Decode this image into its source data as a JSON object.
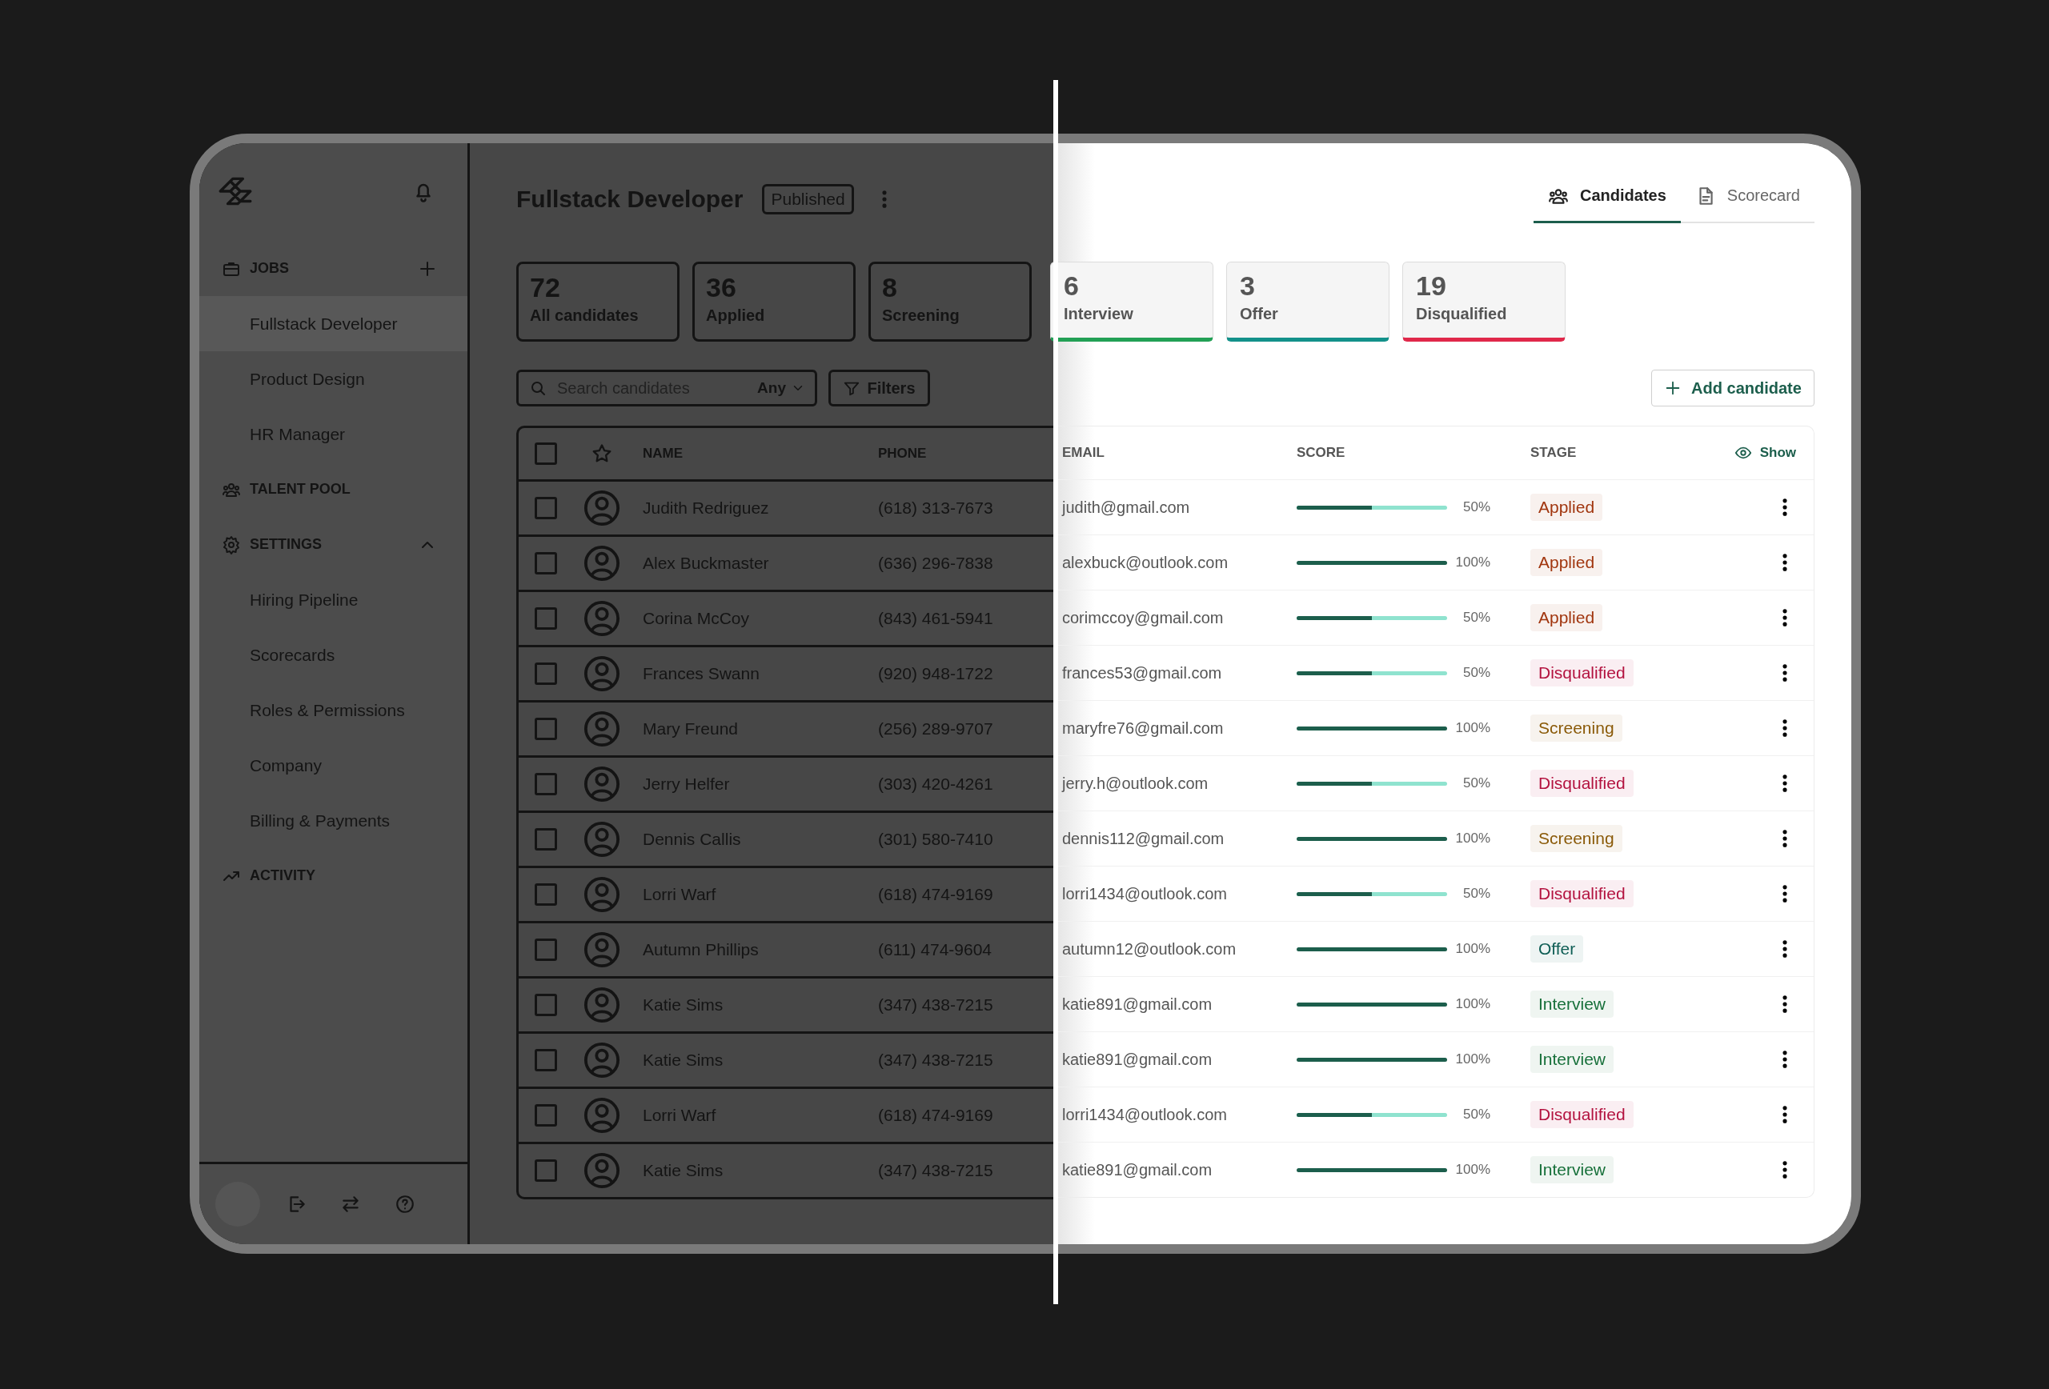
{
  "sidebar": {
    "sections": [
      {
        "kind": "jobs",
        "label": "JOBS",
        "children": [
          {
            "label": "Fullstack Developer",
            "selected": true
          },
          {
            "label": "Product Design",
            "selected": false
          },
          {
            "label": "HR Manager",
            "selected": false
          }
        ]
      },
      {
        "kind": "talent_pool",
        "label": "TALENT POOL"
      },
      {
        "kind": "settings",
        "label": "SETTINGS",
        "expanded": true,
        "children": [
          {
            "label": "Hiring Pipeline",
            "selected": false
          },
          {
            "label": "Scorecards",
            "selected": false
          },
          {
            "label": "Roles & Permissions",
            "selected": false
          },
          {
            "label": "Company",
            "selected": false
          },
          {
            "label": "Billing & Payments",
            "selected": false
          }
        ]
      },
      {
        "kind": "activity",
        "label": "ACTIVITY"
      }
    ]
  },
  "job": {
    "title": "Fullstack Developer",
    "status": "Published"
  },
  "tabs": [
    {
      "label": "Candidates",
      "selected": true
    },
    {
      "label": "Scorecard",
      "selected": false
    }
  ],
  "stats": [
    {
      "count": "72",
      "label": "All candidates"
    },
    {
      "count": "36",
      "label": "Applied"
    },
    {
      "count": "8",
      "label": "Screening"
    },
    {
      "count": "6",
      "label": "Interview",
      "color": "#22a055"
    },
    {
      "count": "3",
      "label": "Offer",
      "color": "#13918a"
    },
    {
      "count": "19",
      "label": "Disqualified",
      "color": "#e0284a"
    }
  ],
  "search": {
    "placeholder": "Search candidates",
    "scope": "Any"
  },
  "filters_button": "Filters",
  "add_button": "Add candidate",
  "table": {
    "all_checked": false,
    "columns": [
      "NAME",
      "PHONE",
      "EMAIL",
      "SCORE",
      "STAGE"
    ],
    "show_button": "Show",
    "rows": [
      {
        "checked": false,
        "name": "Judith Redriguez",
        "phone": "(618) 313-7673",
        "email": "judith@gmail.com",
        "level": 0.5,
        "score": "50%",
        "stage": {
          "label": "Applied",
          "color": "#a1360f"
        }
      },
      {
        "checked": false,
        "name": "Alex Buckmaster",
        "phone": "(636) 296-7838",
        "email": "alexbuck@outlook.com",
        "level": 1,
        "score": "100%",
        "stage": {
          "label": "Applied",
          "color": "#a1360f"
        }
      },
      {
        "checked": false,
        "name": "Corina McCoy",
        "phone": "(843) 461-5941",
        "email": "corimccoy@gmail.com",
        "level": 0.5,
        "score": "50%",
        "stage": {
          "label": "Applied",
          "color": "#a1360f"
        }
      },
      {
        "checked": false,
        "name": "Frances Swann",
        "phone": "(920) 948-1722",
        "email": "frances53@gmail.com",
        "level": 0.5,
        "score": "50%",
        "stage": {
          "label": "Disqualified",
          "color": "#b3123f"
        }
      },
      {
        "checked": false,
        "name": "Mary Freund",
        "phone": "(256) 289-9707",
        "email": "maryfre76@gmail.com",
        "level": 1,
        "score": "100%",
        "stage": {
          "label": "Screening",
          "color": "#8a5a08"
        }
      },
      {
        "checked": false,
        "name": "Jerry Helfer",
        "phone": "(303) 420-4261",
        "email": "jerry.h@outlook.com",
        "level": 0.5,
        "score": "50%",
        "stage": {
          "label": "Disqualified",
          "color": "#b3123f"
        }
      },
      {
        "checked": false,
        "name": "Dennis Callis",
        "phone": "(301) 580-7410",
        "email": "dennis112@gmail.com",
        "level": 1,
        "score": "100%",
        "stage": {
          "label": "Screening",
          "color": "#8a5a08"
        }
      },
      {
        "checked": false,
        "name": "Lorri Warf",
        "phone": "(618) 474-9169",
        "email": "lorri1434@outlook.com",
        "level": 0.5,
        "score": "50%",
        "stage": {
          "label": "Disqualified",
          "color": "#b3123f"
        }
      },
      {
        "checked": false,
        "name": "Autumn Phillips",
        "phone": "(611) 474-9604",
        "email": "autumn12@outlook.com",
        "level": 1,
        "score": "100%",
        "stage": {
          "label": "Offer",
          "color": "#0f5e55"
        }
      },
      {
        "checked": false,
        "name": "Katie Sims",
        "phone": "(347) 438-7215",
        "email": "katie891@gmail.com",
        "level": 1,
        "score": "100%",
        "stage": {
          "label": "Interview",
          "color": "#17703a"
        }
      },
      {
        "checked": false,
        "name": "Katie Sims",
        "phone": "(347) 438-7215",
        "email": "katie891@gmail.com",
        "level": 1,
        "score": "100%",
        "stage": {
          "label": "Interview",
          "color": "#17703a"
        }
      },
      {
        "checked": false,
        "name": "Lorri Warf",
        "phone": "(618) 474-9169",
        "email": "lorri1434@outlook.com",
        "level": 0.5,
        "score": "50%",
        "stage": {
          "label": "Disqualified",
          "color": "#b3123f"
        }
      },
      {
        "checked": false,
        "name": "Katie Sims",
        "phone": "(347) 438-7215",
        "email": "katie891@gmail.com",
        "level": 1,
        "score": "100%",
        "stage": {
          "label": "Interview",
          "color": "#17703a"
        }
      }
    ]
  }
}
